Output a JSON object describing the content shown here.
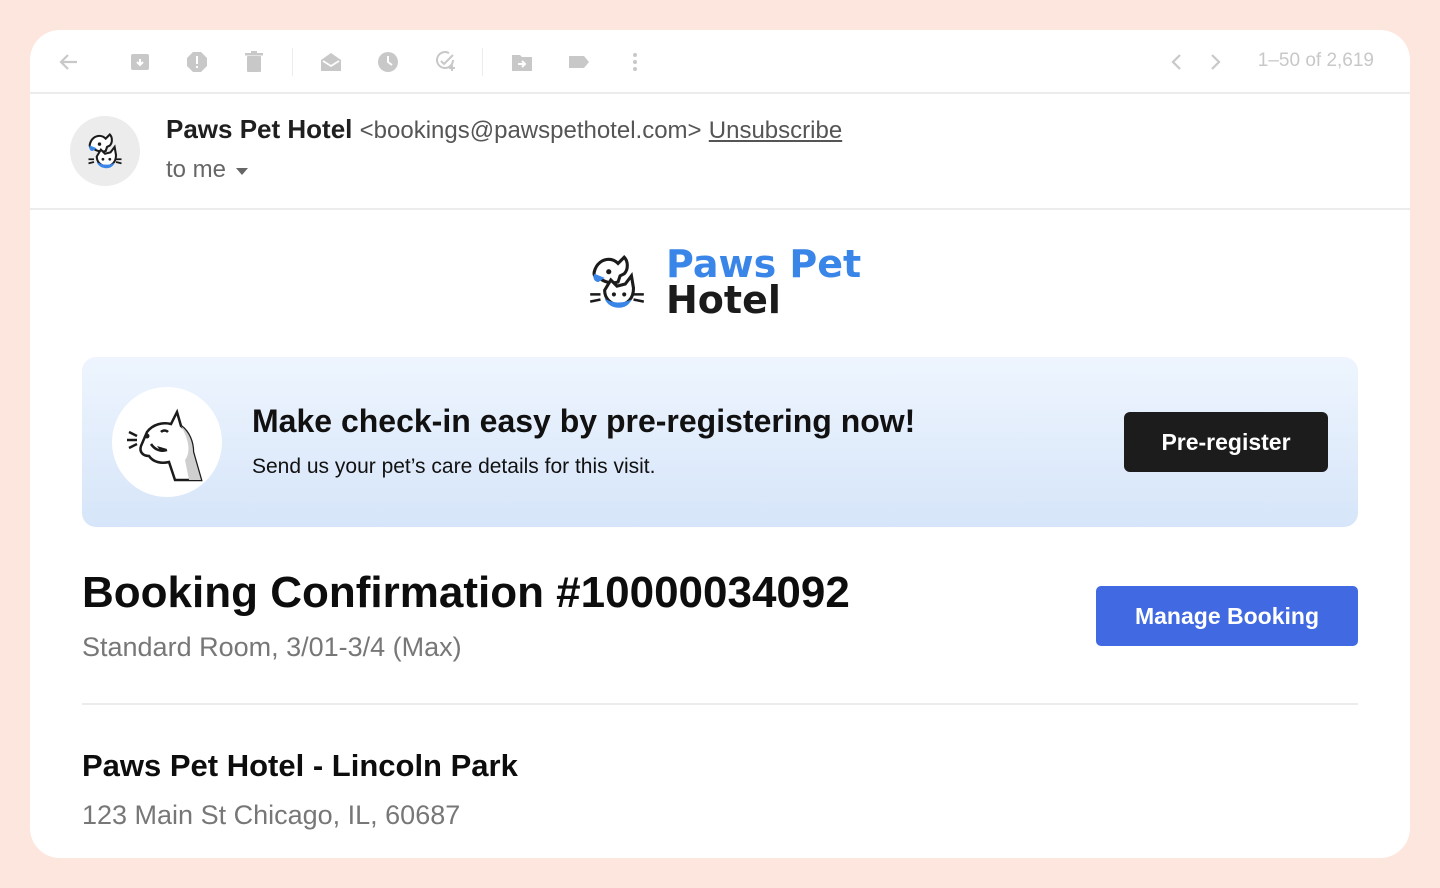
{
  "toolbar": {
    "icons": [
      "back-arrow-icon",
      "archive-icon",
      "report-spam-icon",
      "trash-icon",
      "mark-unread-icon",
      "snooze-clock-icon",
      "add-task-icon",
      "move-to-icon",
      "label-icon",
      "more-vert-icon"
    ],
    "pager_text": "1–50 of 2,619"
  },
  "email": {
    "sender_name": "Paws Pet Hotel",
    "sender_email": "<bookings@pawspethotel.com>",
    "unsubscribe": "Unsubscribe",
    "to_label": "to me"
  },
  "logo": {
    "line1": "Paws Pet",
    "line2": "Hotel",
    "accent_color": "#3a86e8"
  },
  "banner": {
    "title": "Make check-in easy by pre-registering now!",
    "subtitle": "Send us your pet’s care details for this visit.",
    "button_label": "Pre-register"
  },
  "booking": {
    "title": "Booking Confirmation #10000034092",
    "subtitle": "Standard Room, 3/01-3/4 (Max)",
    "manage_label": "Manage Booking",
    "manage_color": "#4169e1"
  },
  "location": {
    "name": "Paws Pet Hotel - Lincoln Park",
    "address": "123 Main St Chicago, IL, 60687"
  }
}
